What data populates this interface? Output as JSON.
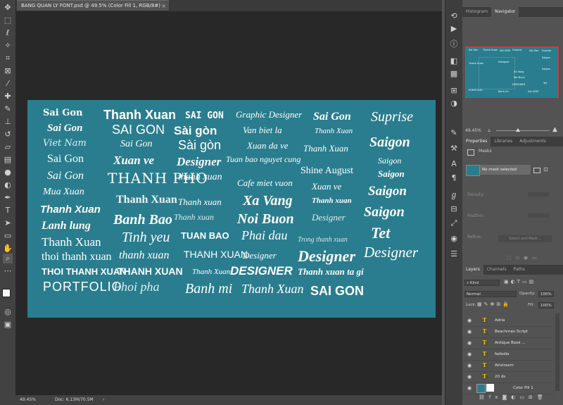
{
  "document_tab": {
    "title": "BANG QUAN LY FONT.psd @ 49.5% (Color Fill 1, RGB/8#)",
    "close": "×"
  },
  "toolbar_icons": [
    "move-icon",
    "marquee-icon",
    "lasso-icon",
    "magic-wand-icon",
    "crop-icon",
    "frame-icon",
    "eyedropper-icon",
    "healing-icon",
    "brush-icon",
    "stamp-icon",
    "history-brush-icon",
    "eraser-icon",
    "gradient-icon",
    "blur-icon",
    "dodge-icon",
    "pen-icon",
    "type-icon",
    "path-select-icon",
    "shape-icon",
    "hand-icon",
    "zoom-icon",
    "edit-toolbar-icon"
  ],
  "canvas_texts": [
    "Sai Gon",
    "Sai Gon",
    "Viet Nam",
    "Sai Gon",
    "Sai Gon",
    "Mua Xuan",
    "Thanh Xuan",
    "Lanh lung",
    "Thanh Xuan",
    "thoi thanh xuan",
    "THOI THANH XUAN",
    "PORTFOLIO",
    "Thanh Xuan",
    "SAI GON",
    "Sai Gon",
    "Xuan ve",
    "THANH PHO",
    "Thanh Xuan",
    "Banh Bao",
    "Tinh yeu",
    "thanh xuan",
    "THANH XUAN",
    "Phoi pha",
    "SAI GON",
    "Sài gòn",
    "Sài gòn",
    "Designer",
    "thanh xuan",
    "Thanh xuan",
    "Thanh xuan",
    "TUAN BAO",
    "THANH XUAN",
    "Thanh Xuan",
    "Banh mi",
    "Graphic Designer",
    "Van biet la",
    "Xuan da ve",
    "Tuan bao nguyet cung",
    "Cafe miet vuon",
    "Xa Vang",
    "Noi Buon",
    "Phai dau",
    "Designer",
    "DESIGNER",
    "Thanh Xuan",
    "Sai Gon",
    "Thanh Xuan",
    "Thanh Xuan",
    "Shine August",
    "Xuan ve",
    "Thanh xuan",
    "Designer",
    "Trong thanh xuan",
    "Designer",
    "Thanh xuan ta gi",
    "SAI GON",
    "Suprise",
    "Saigon",
    "Saigon",
    "Saigon",
    "Saigon",
    "Saigon",
    "Tet",
    "Designer"
  ],
  "status": {
    "zoom": "49.45%",
    "doc": "Doc: 6.13M/70.5M"
  },
  "right_icons": [
    "play-icon",
    "info-icon",
    "color-icon",
    "swatches-icon",
    "libraries-icon",
    "adjustments-icon",
    "tools-icon",
    "properties-icon",
    "history-icon",
    "layers-comps-icon",
    "brush-settings-icon",
    "color-wheel-icon",
    "character-icon"
  ],
  "navigator": {
    "tabs": [
      "Histogram",
      "Navigator"
    ],
    "zoom": "49.45%",
    "mini": [
      "Sai Gon",
      "Thanh Xuan",
      "SAI GON",
      "Graphic",
      "Sai Gon",
      "Suprise",
      "Saigon",
      "Thanh Xuan",
      "Designer",
      "Xa Vang",
      "Noi Buon",
      "Saigon",
      "DESIGNER",
      "SAI GON",
      "PORTFOLIO",
      "Banh mi",
      "Tet"
    ]
  },
  "properties": {
    "tabs": [
      "Properties",
      "Libraries",
      "Adjustments"
    ],
    "masks_label": "Masks",
    "no_mask": "No mask selected",
    "density_label": "Density:",
    "feather_label": "Feather:",
    "refine_label": "Refine:",
    "select_mask": "Select and Mask..."
  },
  "layers": {
    "tabs": [
      "Layers",
      "Channels",
      "Paths"
    ],
    "filter": "Kind",
    "blend_mode": "Normal",
    "opacity_label": "Opacity:",
    "opacity": "100%",
    "lock_label": "Lock:",
    "fill_label": "Fill:",
    "fill": "100%",
    "items": [
      {
        "name": "Adria",
        "type": "T"
      },
      {
        "name": "Beachman Script",
        "type": "T"
      },
      {
        "name": "Antique Book ...",
        "type": "T"
      },
      {
        "name": "fadodia",
        "type": "T"
      },
      {
        "name": "Airstream",
        "type": "T"
      },
      {
        "name": "20 ds",
        "type": "T"
      },
      {
        "name": "Color Fill 1",
        "type": "fill"
      }
    ]
  },
  "colors": {
    "canvas": "#2a7d8e",
    "panel": "#535353",
    "dark": "#282828",
    "accent": "#e03a2f"
  }
}
